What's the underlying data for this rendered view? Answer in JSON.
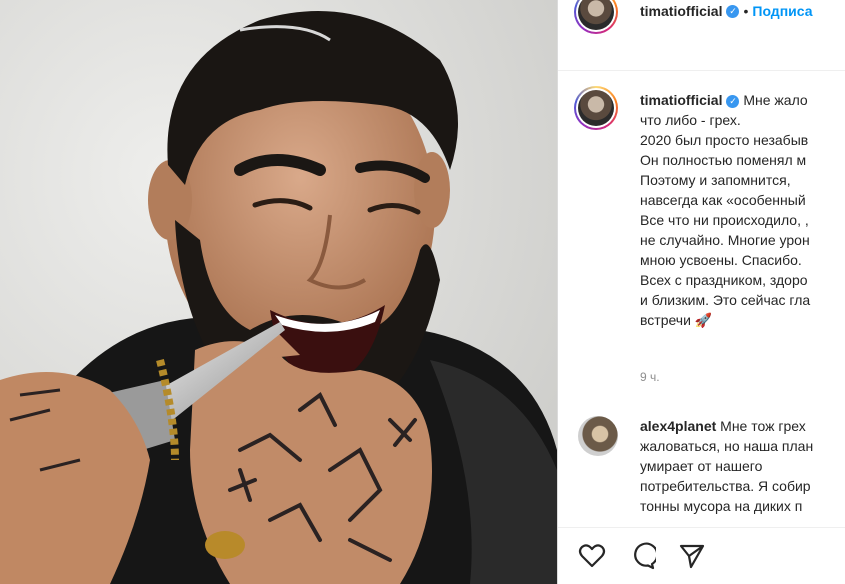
{
  "post": {
    "username": "timatiofficial",
    "follow_label": "Подписа",
    "verified_icon": "verified-badge-icon",
    "caption_lines": [
      "Мне жало",
      "что либо - грех.",
      "2020 был просто незабыв",
      "Он полностью поменял м",
      "Поэтому и запомнится,",
      "навсегда как «особенный",
      "Все что ни происходило, ,",
      "не случайно. Многие урон",
      "мною усвоены. Спасибо.",
      "Всех с праздником, здоро",
      "и близким. Это сейчас гла",
      "встречи 🚀"
    ],
    "time": "9 ч."
  },
  "comment": {
    "username": "alex4planet",
    "lines": [
      "Мне тож грех",
      "жаловаться, но наша план",
      "умирает от нашего",
      "потребительства. Я собир",
      "тонны мусора на диких п"
    ]
  },
  "actions": {
    "like_icon": "heart-icon",
    "comment_icon": "comment-icon",
    "share_icon": "share-icon"
  },
  "colors": {
    "accent": "#0095f6",
    "text": "#262626",
    "muted": "#8e8e8e"
  }
}
